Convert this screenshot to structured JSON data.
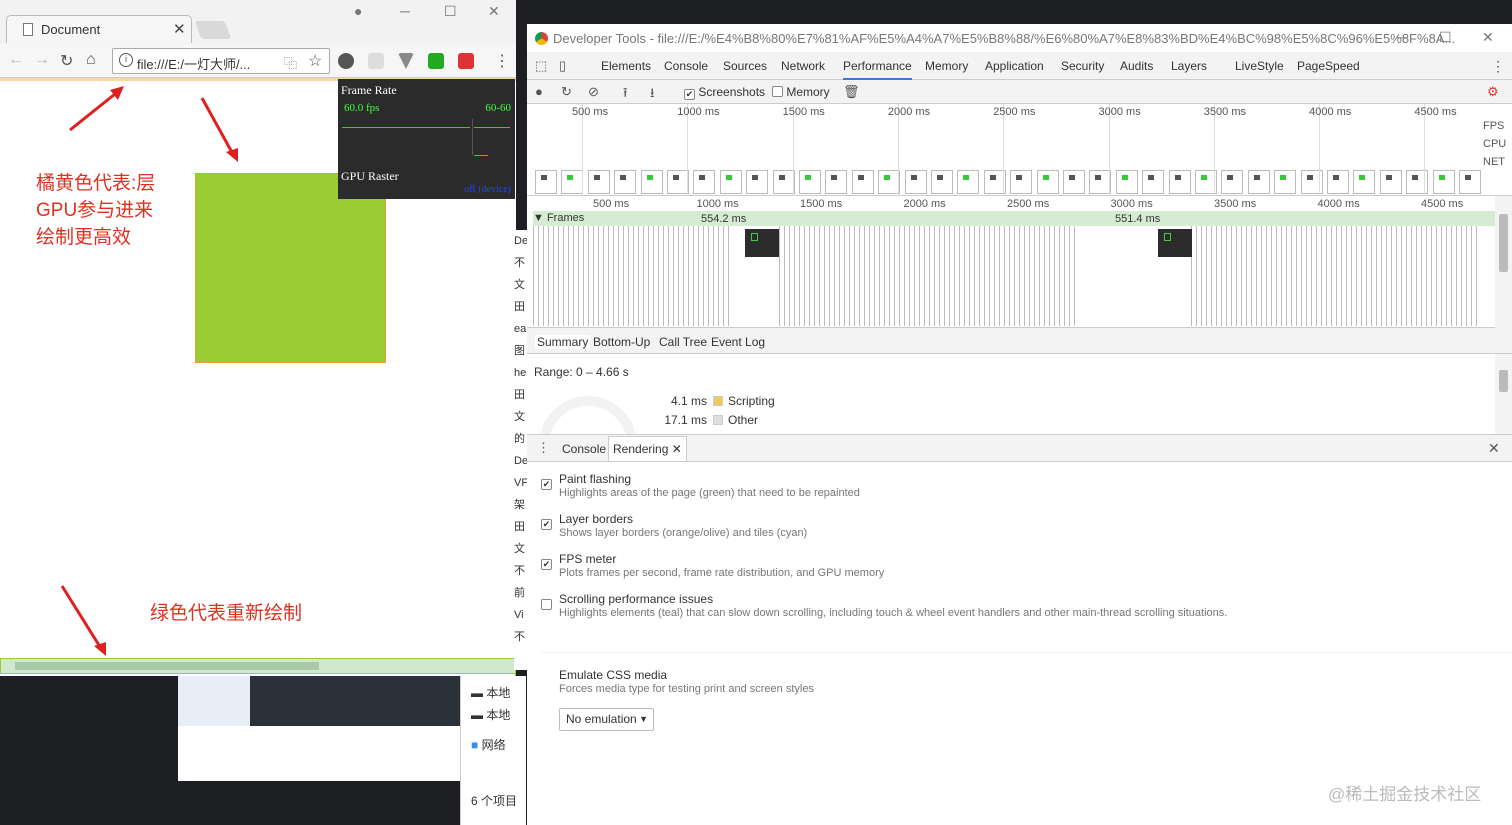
{
  "browser": {
    "tab_title": "Document",
    "url": "file:///E:/一灯大师/...",
    "window_buttons": [
      "─",
      "☐",
      "✕"
    ]
  },
  "fps_meter": {
    "title": "Frame Rate",
    "fps": "60.0 fps",
    "range": "60-60",
    "gpu_raster_label": "GPU Raster",
    "gpu_raster_value": "off (device)"
  },
  "annotations": {
    "orange_note": "橘黄色代表:层\nGPU参与进来\n绘制更高效",
    "green_note": "绿色代表重新绘制"
  },
  "explorer": {
    "items": [
      "本地",
      "本地",
      "网络"
    ],
    "count": "6 个项目"
  },
  "sidebar_clip": [
    "De",
    "不",
    "文",
    "田",
    "ea",
    "图",
    "he",
    "田",
    "文",
    "的",
    "De",
    "VF",
    "架",
    "田",
    "文",
    "不",
    "前",
    "Vi",
    "不"
  ],
  "devtools": {
    "title": "Developer Tools - file:///E:/%E4%B8%80%E7%81%AF%E5%A4%A7%E5%B8%88/%E6%80%A7%E8%83%BD%E4%BC%98%E5%8C%96%E5%8F%8A...",
    "tabs": [
      "Elements",
      "Console",
      "Sources",
      "Network",
      "Performance",
      "Memory",
      "Application",
      "Security",
      "Audits",
      "Layers",
      "LiveStyle",
      "PageSpeed"
    ],
    "selected_tab": "Performance",
    "toolbar": {
      "screenshots_label": "Screenshots",
      "screenshots_checked": true,
      "memory_label": "Memory",
      "memory_checked": false
    },
    "overview_ticks": [
      "500 ms",
      "1000 ms",
      "1500 ms",
      "2000 ms",
      "2500 ms",
      "3000 ms",
      "3500 ms",
      "4000 ms",
      "4500 ms"
    ],
    "track_labels": [
      "FPS",
      "CPU",
      "NET"
    ],
    "flame_ticks": [
      "500 ms",
      "1000 ms",
      "1500 ms",
      "2000 ms",
      "2500 ms",
      "3000 ms",
      "3500 ms",
      "4000 ms",
      "4500 ms"
    ],
    "frames_label": "Frames",
    "frame_durations": [
      "554.2 ms",
      "551.4 ms"
    ],
    "summary_tabs": [
      "Summary",
      "Bottom-Up",
      "Call Tree",
      "Event Log"
    ],
    "range": "Range: 0 – 4.66 s",
    "summary_rows": [
      {
        "value": "4.1 ms",
        "label": "Scripting",
        "color": "#f1c95b"
      },
      {
        "value": "17.1 ms",
        "label": "Other",
        "color": "#dddddd"
      }
    ],
    "drawer_tabs": [
      "Console",
      "Rendering"
    ],
    "rendering_options": [
      {
        "title": "Paint flashing",
        "desc": "Highlights areas of the page (green) that need to be repainted",
        "checked": true
      },
      {
        "title": "Layer borders",
        "desc": "Shows layer borders (orange/olive) and tiles (cyan)",
        "checked": true
      },
      {
        "title": "FPS meter",
        "desc": "Plots frames per second, frame rate distribution, and GPU memory",
        "checked": true
      },
      {
        "title": "Scrolling performance issues",
        "desc": "Highlights elements (teal) that can slow down scrolling, including touch & wheel event handlers and other main-thread scrolling situations.",
        "checked": false
      }
    ],
    "emulate": {
      "title": "Emulate CSS media",
      "desc": "Forces media type for testing print and screen styles",
      "value": "No emulation"
    }
  },
  "watermark": "@稀土掘金技术社区"
}
